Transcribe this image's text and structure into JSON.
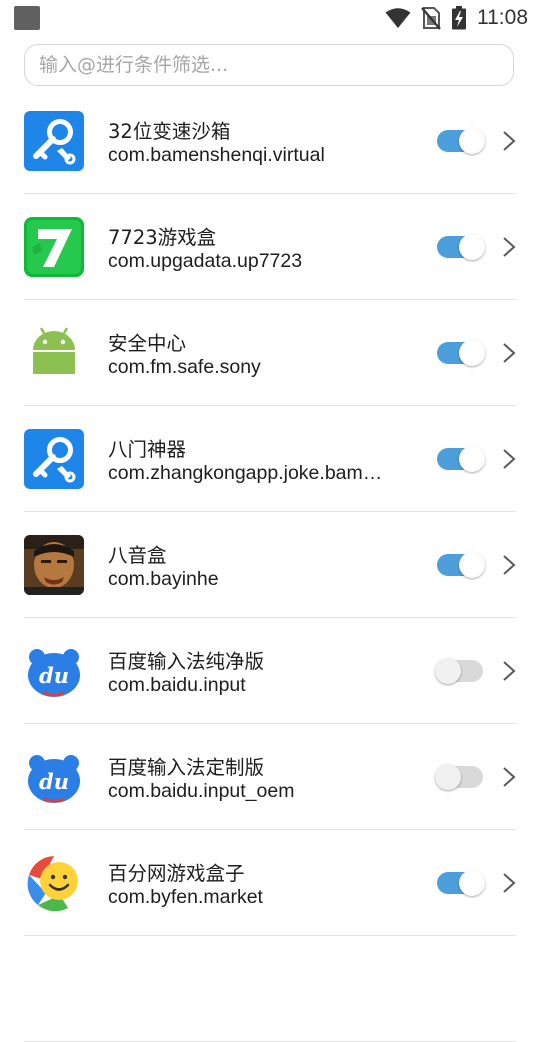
{
  "status_bar": {
    "time": "11:08"
  },
  "search": {
    "placeholder": "输入@进行条件筛选..."
  },
  "apps": [
    {
      "name": "32位变速沙箱",
      "package": "com.bamenshenqi.virtual",
      "enabled": true,
      "icon": "key-wrench-icon"
    },
    {
      "name": "7723游戏盒",
      "package": "com.upgadata.up7723",
      "enabled": true,
      "icon": "seven-icon"
    },
    {
      "name": "安全中心",
      "package": "com.fm.safe.sony",
      "enabled": true,
      "icon": "android-icon"
    },
    {
      "name": "八门神器",
      "package": "com.zhangkongapp.joke.bam…",
      "enabled": true,
      "icon": "key-wrench-icon"
    },
    {
      "name": "八音盒",
      "package": "com.bayinhe",
      "enabled": true,
      "icon": "face-photo-icon"
    },
    {
      "name": "百度输入法纯净版",
      "package": "com.baidu.input",
      "enabled": false,
      "icon": "baidu-du-icon"
    },
    {
      "name": "百度输入法定制版",
      "package": "com.baidu.input_oem",
      "enabled": false,
      "icon": "baidu-du-icon"
    },
    {
      "name": "百分网游戏盒子",
      "package": "com.byfen.market",
      "enabled": true,
      "icon": "smiley-icon"
    }
  ],
  "colors": {
    "toggle_on": "#4d9fdb",
    "toggle_off": "#d9d9d9"
  }
}
